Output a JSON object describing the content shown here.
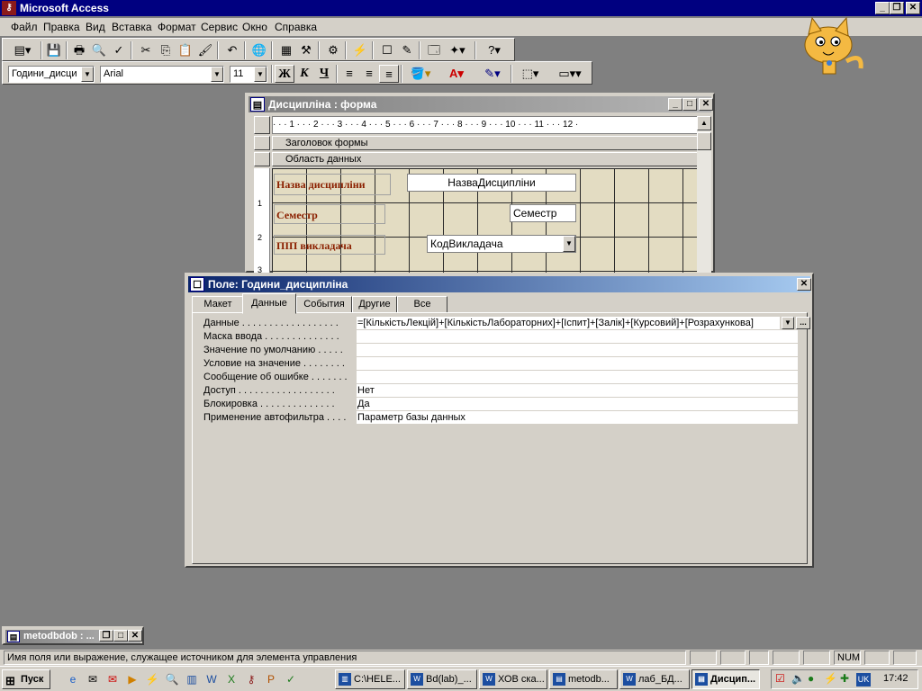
{
  "app": {
    "title": "Microsoft Access",
    "icon": "access-key-icon"
  },
  "menu": [
    "Файл",
    "Правка",
    "Вид",
    "Вставка",
    "Формат",
    "Сервис",
    "Окно",
    "Справка"
  ],
  "toolbar_format": {
    "object": "Години_дисци",
    "font": "Arial",
    "size": "11",
    "bold": "Ж",
    "italic": "К",
    "underline": "Ч"
  },
  "form_window": {
    "title": "Дисципліна : форма",
    "ruler": "· · · 1 · · · 2 · · · 3 · · · 4 · · · 5 · · · 6 · · · 7 · · · 8 · · · 9 · · · 10 · · · 11 · · · 12 ·",
    "header_section": "Заголовок формы",
    "detail_section": "Область данных",
    "vruler": [
      "1",
      "2",
      "3"
    ],
    "fields": [
      {
        "label": "Назва дисципліни",
        "control": "НазваДисципліни"
      },
      {
        "label": "Семестр",
        "control": "Семестр"
      },
      {
        "label": "ПІП викладача",
        "control": "КодВикладача"
      }
    ]
  },
  "property_sheet": {
    "title": "Поле: Години_дисципліна",
    "tabs": [
      "Макет",
      "Данные",
      "События",
      "Другие",
      "Все"
    ],
    "selected_tab": "Данные",
    "properties": [
      {
        "label": "Данные . . . . . . . . . . . . . . . . . .",
        "value": "=[КількістьЛекцій]+[КількістьЛабораторних]+[Іспит]+[Залік]+[Курсовий]+[Розрахункова]"
      },
      {
        "label": "Маска ввода . . . . . . . . . . . . . .",
        "value": ""
      },
      {
        "label": "Значение по умолчанию . . . . .",
        "value": ""
      },
      {
        "label": "Условие на значение . . . . . . . .",
        "value": ""
      },
      {
        "label": "Сообщение об ошибке . . . . . . .",
        "value": ""
      },
      {
        "label": "Доступ . . . . . . . . . . . . . . . . . .",
        "value": "Нет"
      },
      {
        "label": "Блокировка . . . . . . . . . . . . . .",
        "value": "Да"
      },
      {
        "label": "Применение автофильтра . . . .",
        "value": "Параметр базы данных"
      }
    ]
  },
  "minimized_window": {
    "title": "metodbdob : ..."
  },
  "status": {
    "message": "Имя поля или выражение, служащее источником для элемента управления",
    "num": "NUM"
  },
  "taskbar": {
    "start": "Пуск",
    "tasks": [
      "C:\\HELE...",
      "Bd(lab)_...",
      "ХОВ cка...",
      "metodb...",
      "лаб_БД...",
      "Дисцип..."
    ],
    "lang": "UK",
    "time": "17:42"
  }
}
